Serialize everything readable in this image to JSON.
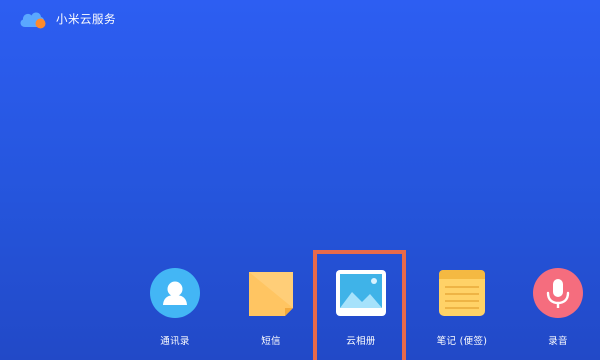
{
  "brand": {
    "title": "小米云服务",
    "logo_icon": "cloud-icon",
    "logo_colors": {
      "cloud": "#5aa8ff",
      "dot": "#ff8a2b"
    }
  },
  "apps": [
    {
      "key": "contacts",
      "label": "通讯录",
      "icon": "person-icon",
      "color": "#43b6f5"
    },
    {
      "key": "sms",
      "label": "短信",
      "icon": "message-icon",
      "color": "#ffc562"
    },
    {
      "key": "gallery",
      "label": "云相册",
      "icon": "landscape-photo-icon",
      "color": "#3fb3e8",
      "selected": true
    },
    {
      "key": "notes",
      "label": "笔记 (便签)",
      "icon": "notepad-icon",
      "color": "#ffd267"
    },
    {
      "key": "recorder",
      "label": "录音",
      "icon": "microphone-icon",
      "color": "#f56d7e"
    }
  ],
  "colors": {
    "background": "#2555dc",
    "highlight": "#e86a4a"
  }
}
